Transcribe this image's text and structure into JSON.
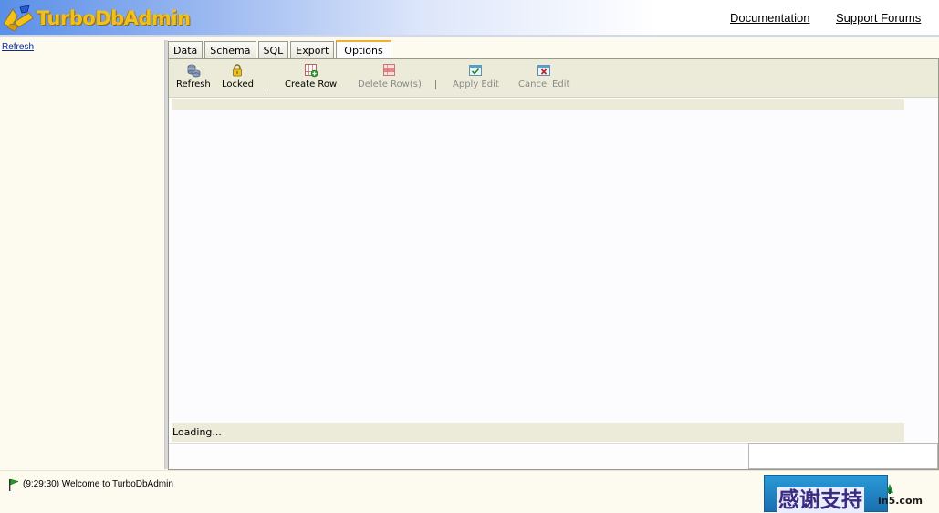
{
  "app": {
    "logo_text": "TurboDbAdmin",
    "brand_color": "#f0c020"
  },
  "header": {
    "links": {
      "documentation": "Documentation",
      "support_forums": "Support Forums"
    }
  },
  "sidebar": {
    "refresh_label": "Refresh"
  },
  "tabs": [
    {
      "label": "Data",
      "active": false
    },
    {
      "label": "Schema",
      "active": false
    },
    {
      "label": "SQL",
      "active": false
    },
    {
      "label": "Export",
      "active": false
    },
    {
      "label": "Options",
      "active": true
    }
  ],
  "toolbar": {
    "refresh": {
      "label": "Refresh",
      "icon": "database-refresh-icon",
      "enabled": true
    },
    "locked": {
      "label": "Locked",
      "icon": "lock-icon",
      "enabled": true
    },
    "separator": "|",
    "create_row": {
      "label": "Create Row",
      "icon": "create-row-icon",
      "enabled": true
    },
    "delete_rows": {
      "label": "Delete Row(s)",
      "icon": "delete-row-icon",
      "enabled": false
    },
    "apply_edit": {
      "label": "Apply Edit",
      "icon": "apply-edit-icon",
      "enabled": false
    },
    "cancel_edit": {
      "label": "Cancel Edit",
      "icon": "cancel-edit-icon",
      "enabled": false
    }
  },
  "grid": {
    "status_text": "Loading..."
  },
  "footer": {
    "welcome_message": "(9:29:30) Welcome to TurboDbAdmin",
    "flag_icon": "green-flag-icon"
  },
  "watermark": {
    "text": "感谢支持",
    "url": "in5.com"
  }
}
